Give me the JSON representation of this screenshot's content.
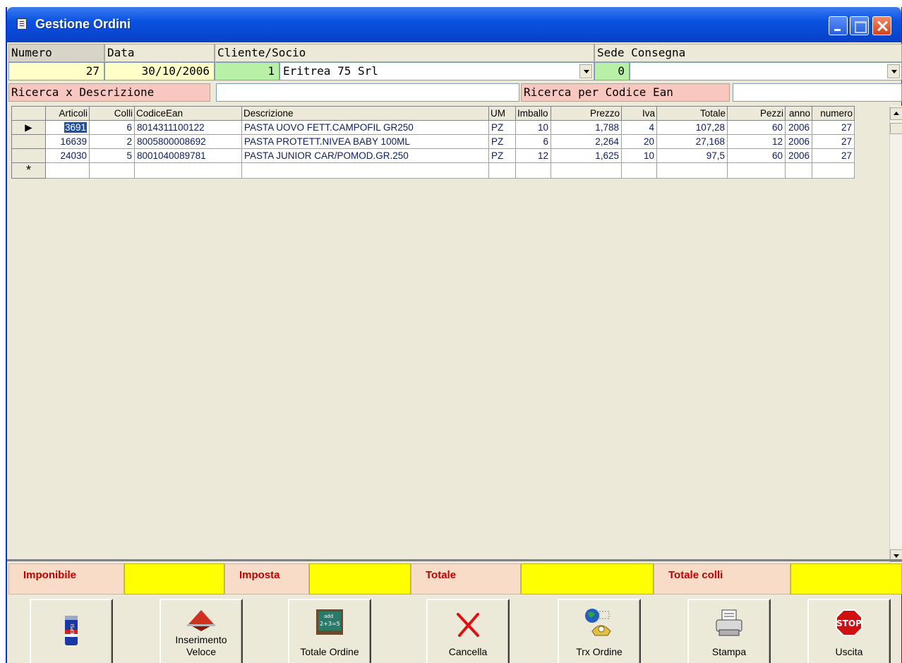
{
  "window": {
    "title": "Gestione Ordini"
  },
  "header": {
    "numero_label": "Numero",
    "data_label": "Data",
    "cliente_label": "Cliente/Socio",
    "sede_label": "Sede Consegna",
    "numero_value": "27",
    "data_value": "30/10/2006",
    "cliente_code": "1",
    "cliente_name": "Eritrea 75 Srl",
    "sede_code": "0",
    "sede_name": "",
    "ricerca_desc_label": "Ricerca x Descrizione",
    "ricerca_desc_value": "",
    "ricerca_ean_label": "Ricerca per Codice Ean",
    "ricerca_ean_value": ""
  },
  "grid": {
    "columns": [
      "Articoli",
      "Colli",
      "CodiceEan",
      "Descrizione",
      "UM",
      "Imballo",
      "Prezzo",
      "Iva",
      "Totale",
      "Pezzi",
      "anno",
      "numero"
    ],
    "rows": [
      [
        "3691",
        "6",
        "8014311100122",
        "PASTA UOVO FETT.CAMPOFIL GR250",
        "PZ",
        "10",
        "1,788",
        "4",
        "107,28",
        "60",
        "2006",
        "27"
      ],
      [
        "16639",
        "2",
        "8005800008692",
        "PASTA PROTETT.NIVEA BABY 100ML",
        "PZ",
        "6",
        "2,264",
        "20",
        "27,168",
        "12",
        "2006",
        "27"
      ],
      [
        "24030",
        "5",
        "8001040089781",
        "PASTA JUNIOR CAR/POMOD.GR.250",
        "PZ",
        "12",
        "1,625",
        "10",
        "97,5",
        "60",
        "2006",
        "27"
      ]
    ],
    "new_row_marker": "*",
    "current_row_marker": "▶"
  },
  "totals": {
    "imponibile_label": "Imponibile",
    "imposta_label": "Imposta",
    "totale_label": "Totale",
    "totale_colli_label": "Totale colli"
  },
  "buttons": {
    "pepsi": "",
    "inserimento_1": "Inserimento",
    "inserimento_2": "Veloce",
    "totale_ordine": "Totale Ordine",
    "cancella": "Cancella",
    "trx_ordine": "Trx Ordine",
    "stampa": "Stampa",
    "uscita": "Uscita",
    "stop_text": "STOP",
    "pepsi_text": "PEPSI",
    "calc_text_1": "add",
    "calc_text_2": "2+3=5"
  }
}
